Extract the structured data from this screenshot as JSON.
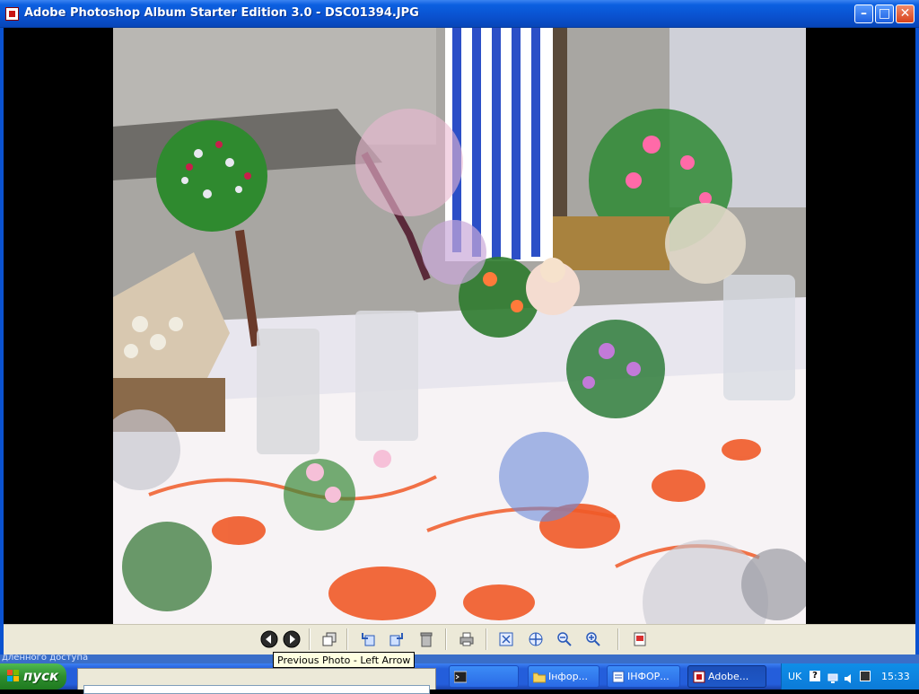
{
  "window": {
    "title": "Adobe Photoshop Album Starter Edition 3.0 - DSC01394.JPG",
    "controls": {
      "minimize": "–",
      "maximize": "□",
      "close": "✕"
    }
  },
  "toolbar": {
    "buttons": [
      {
        "name": "previous-photo",
        "icon": "left-arrow-circle-icon"
      },
      {
        "name": "next-photo",
        "icon": "right-arrow-circle-icon"
      },
      {
        "name": "slideshow",
        "icon": "stack-icon"
      },
      {
        "name": "rotate-left",
        "icon": "rotate-left-icon"
      },
      {
        "name": "rotate-right",
        "icon": "rotate-right-icon"
      },
      {
        "name": "delete",
        "icon": "trash-icon"
      },
      {
        "name": "print",
        "icon": "printer-icon"
      },
      {
        "name": "fit-window",
        "icon": "fit-window-icon"
      },
      {
        "name": "actual-size",
        "icon": "actual-size-icon"
      },
      {
        "name": "zoom-out",
        "icon": "zoom-out-icon"
      },
      {
        "name": "zoom-in",
        "icon": "zoom-in-icon"
      },
      {
        "name": "fix",
        "icon": "edit-icon"
      }
    ]
  },
  "tooltip": {
    "text": "Previous Photo - Left Arrow"
  },
  "background_window": {
    "text": "дленного доступа"
  },
  "taskbar": {
    "start_label": "пуск",
    "tasks": [
      {
        "label": "",
        "icon": "terminal-icon",
        "active": false
      },
      {
        "label": "Інфор...",
        "icon": "folder-icon",
        "active": false
      },
      {
        "label": "ІНФОР...",
        "icon": "document-icon",
        "active": false
      },
      {
        "label": "Adobe...",
        "icon": "photoshop-album-icon",
        "active": true
      }
    ],
    "tray": {
      "language": "UK",
      "help": "?",
      "clock": "15:33"
    }
  },
  "colors": {
    "titlebar": "#0a52d0",
    "taskbar": "#245edb",
    "start": "#2e8e2e",
    "tooltip_bg": "#ffffe1",
    "toolbar_bg": "#ece9d8"
  }
}
